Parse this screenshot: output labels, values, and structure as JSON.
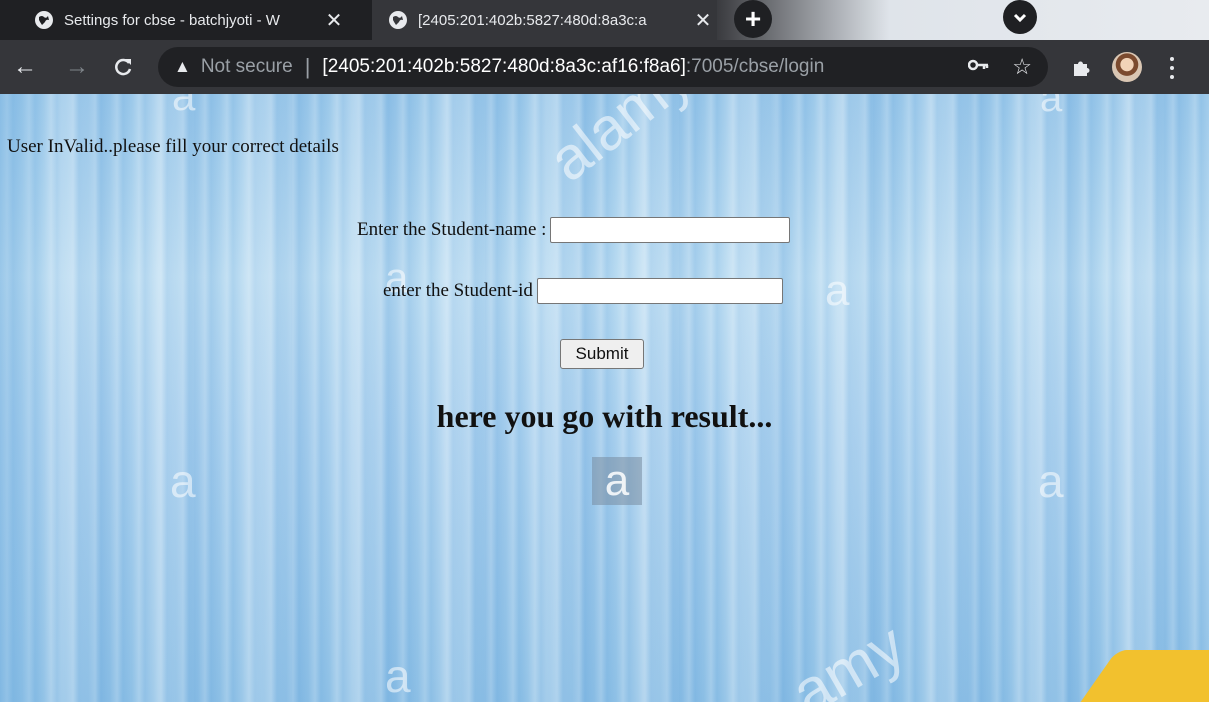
{
  "browser": {
    "tabs": [
      {
        "title": "Settings for cbse - batchjyoti - W",
        "close": "✕",
        "active": false
      },
      {
        "title": "[2405:201:402b:5827:480d:8a3c:a",
        "close": "✕",
        "active": true
      }
    ],
    "new_tab": "+",
    "address": {
      "security_label": "Not secure",
      "separator": "|",
      "host": "[2405:201:402b:5827:480d:8a3c:af16:f8a6]",
      "path": ":7005/cbse/login"
    },
    "icons": {
      "back": "back-arrow-icon",
      "forward": "forward-arrow-icon",
      "reload": "reload-icon",
      "warning": "warning-icon",
      "key": "key-icon",
      "star": "star-icon",
      "extensions": "puzzle-icon",
      "profile": "avatar",
      "menu": "kebab-menu-icon"
    }
  },
  "page": {
    "error_message": "User InValid..please fill your correct details",
    "form": {
      "name_label": "Enter the Student-name :",
      "name_value": "",
      "id_label": "enter the Student-id",
      "id_value": "",
      "submit_label": "Submit"
    },
    "result_heading": "here you go with result...",
    "background": {
      "watermarks": [
        "a",
        "alamy",
        "a",
        "a",
        "a",
        "a",
        "a",
        "a",
        "amy",
        "a"
      ],
      "colors": {
        "base": "#a9d0ee",
        "accent": "#f2c12e"
      }
    }
  }
}
